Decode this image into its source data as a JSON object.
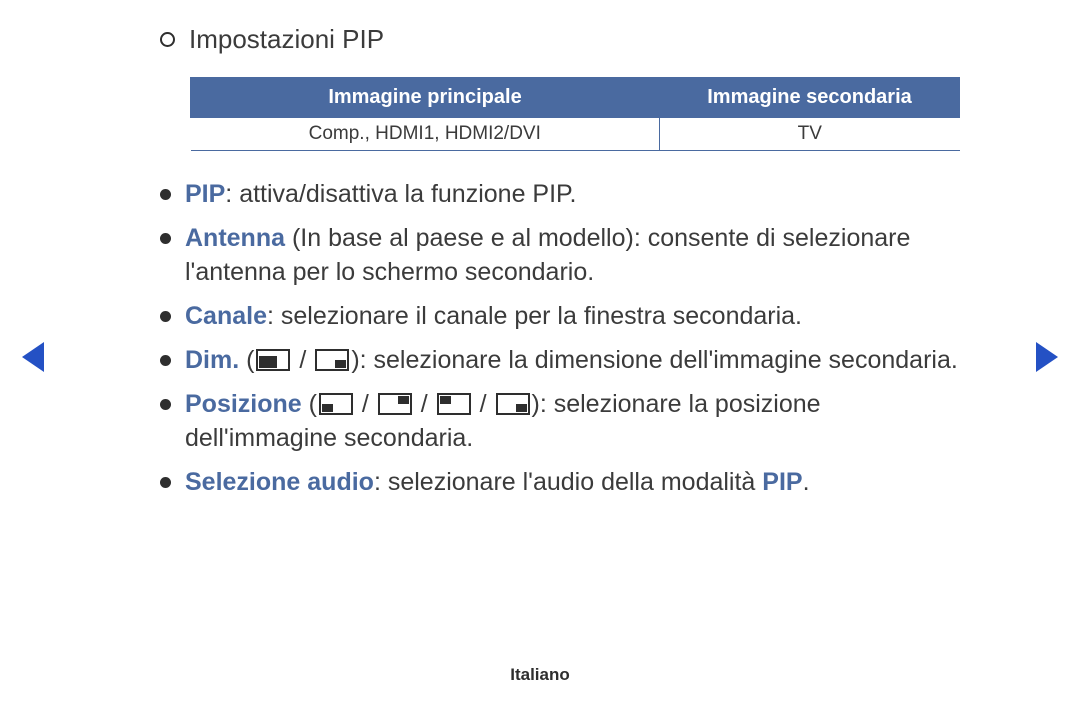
{
  "title": "Impostazioni PIP",
  "table": {
    "headers": {
      "main": "Immagine principale",
      "sub": "Immagine secondaria"
    },
    "row": {
      "main": "Comp., HDMI1, HDMI2/DVI",
      "sub": "TV"
    }
  },
  "items": {
    "pip": {
      "kw": "PIP",
      "text": ": attiva/disattiva la funzione PIP."
    },
    "antenna": {
      "kw": "Antenna",
      "text": " (In base al paese e al modello): consente di selezionare l'antenna per lo schermo secondario."
    },
    "canale": {
      "kw": "Canale",
      "text": ": selezionare il canale per la finestra secondaria."
    },
    "dim": {
      "kw": "Dim.",
      "before": " (",
      "sep": " / ",
      "after": "): selezionare la dimensione dell'immagine secondaria."
    },
    "pos": {
      "kw": "Posizione",
      "before": " (",
      "sep": " / ",
      "after": "): selezionare la posizione dell'immagine secondaria."
    },
    "audio": {
      "kw": "Selezione audio",
      "text": ": selezionare l'audio della modalità ",
      "kw2": "PIP",
      "tail": "."
    }
  },
  "footer": "Italiano"
}
